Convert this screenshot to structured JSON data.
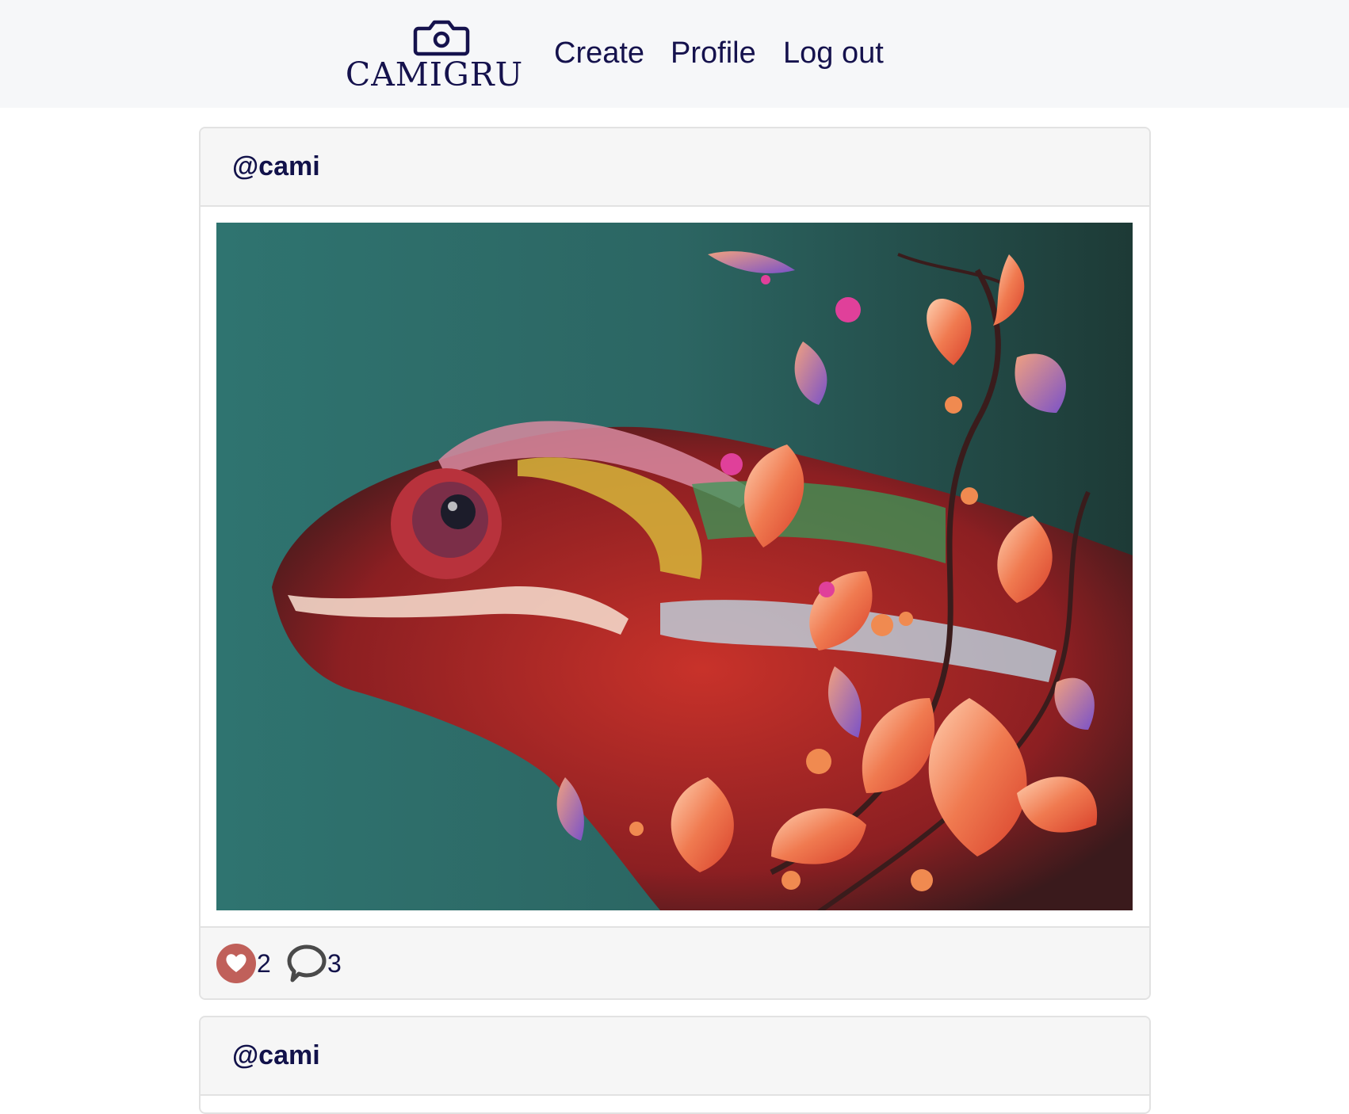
{
  "navbar": {
    "logo_text": "CAMIGRU",
    "links": [
      "Create",
      "Profile",
      "Log out"
    ]
  },
  "posts": [
    {
      "username": "@cami",
      "image_description_icon": "chameleon-photo",
      "likes": "2",
      "comments": "3",
      "liked": true
    },
    {
      "username": "@cami"
    }
  ],
  "colors": {
    "primary_text": "#15124d",
    "like_active": "#c0605a",
    "comment_icon": "#4a4a4a",
    "navbar_bg": "#f6f7f9",
    "card_bg": "#f6f6f6"
  }
}
